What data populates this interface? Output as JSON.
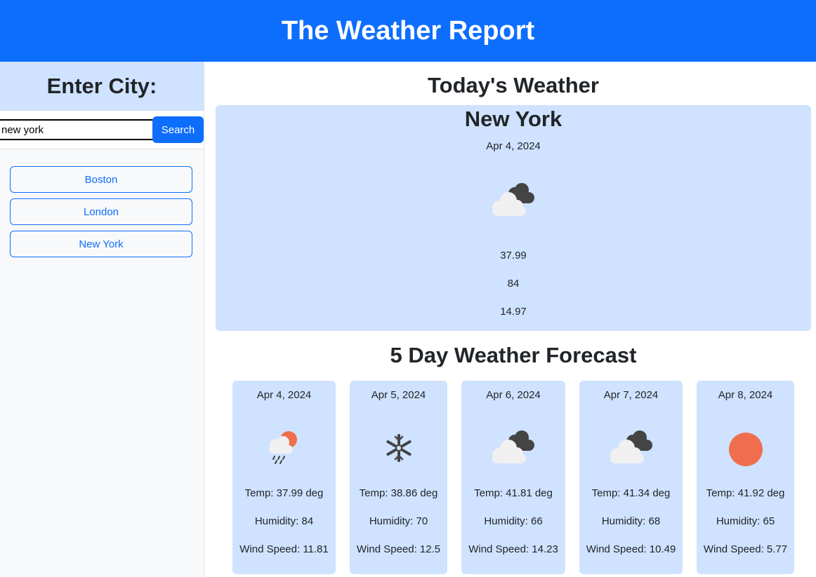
{
  "header": {
    "title": "The Weather Report"
  },
  "sidebar": {
    "heading": "Enter City:",
    "search_value": "new york",
    "search_button": "Search",
    "history": [
      "Boston",
      "London",
      "New York"
    ]
  },
  "today": {
    "heading": "Today's Weather",
    "city": "New York",
    "date": "Apr 4, 2024",
    "icon": "cloudy-icon",
    "temp": "37.99",
    "humidity": "84",
    "wind": "14.97"
  },
  "forecast": {
    "heading": "5 Day Weather Forecast",
    "days": [
      {
        "date": "Apr 4, 2024",
        "icon": "rain-sun-icon",
        "temp": "Temp: 37.99 deg",
        "humidity": "Humidity: 84",
        "wind": "Wind Speed: 11.81"
      },
      {
        "date": "Apr 5, 2024",
        "icon": "snowflake-icon",
        "temp": "Temp: 38.86 deg",
        "humidity": "Humidity: 70",
        "wind": "Wind Speed: 12.5"
      },
      {
        "date": "Apr 6, 2024",
        "icon": "cloudy-icon",
        "temp": "Temp: 41.81 deg",
        "humidity": "Humidity: 66",
        "wind": "Wind Speed: 14.23"
      },
      {
        "date": "Apr 7, 2024",
        "icon": "cloudy-icon",
        "temp": "Temp: 41.34 deg",
        "humidity": "Humidity: 68",
        "wind": "Wind Speed: 10.49"
      },
      {
        "date": "Apr 8, 2024",
        "icon": "sun-icon",
        "temp": "Temp: 41.92 deg",
        "humidity": "Humidity: 65",
        "wind": "Wind Speed: 5.77"
      }
    ]
  },
  "colors": {
    "primary": "#0d6efd",
    "card": "#cfe2ff",
    "sun": "#ef6e4d",
    "cloud_dark": "#444444",
    "cloud_light": "#f0f0f0"
  }
}
